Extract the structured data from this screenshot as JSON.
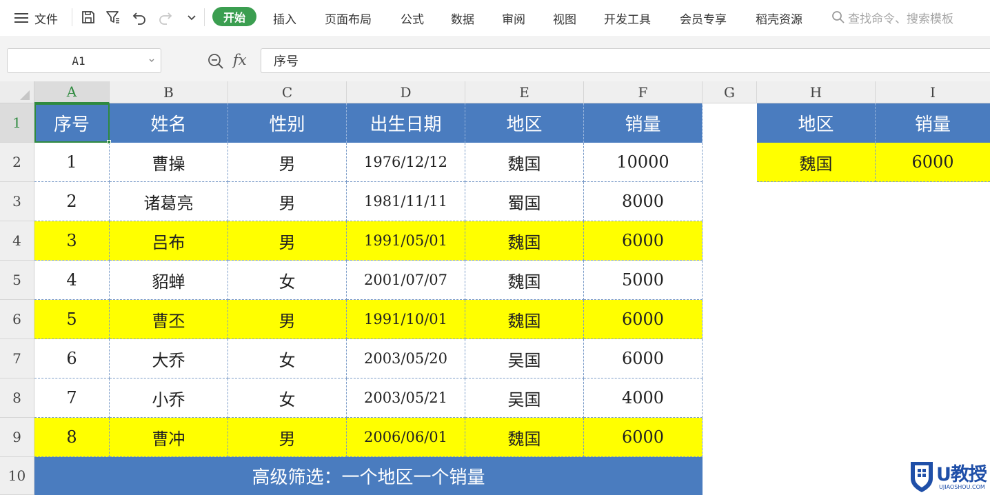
{
  "ribbon": {
    "file_label": "文件",
    "tabs": [
      "开始",
      "插入",
      "页面布局",
      "公式",
      "数据",
      "审阅",
      "视图",
      "开发工具",
      "会员专享",
      "稻壳资源"
    ],
    "active_tab": "开始",
    "search_placeholder": "查找命令、搜索模板",
    "accent_color": "#3b9e50"
  },
  "formula_bar": {
    "cell_ref": "A1",
    "fx_label": "fx",
    "formula": "序号"
  },
  "sheet": {
    "columns": [
      "A",
      "B",
      "C",
      "D",
      "E",
      "F",
      "G",
      "H",
      "I"
    ],
    "rows": [
      "1",
      "2",
      "3",
      "4",
      "5",
      "6",
      "7",
      "8",
      "9",
      "10"
    ],
    "selected_cell": "A1",
    "header_fill": "#4a7cbf",
    "highlight_fill": "#ffff00",
    "table_headers": [
      "序号",
      "姓名",
      "性别",
      "出生日期",
      "地区",
      "销量"
    ],
    "table_rows": [
      [
        "1",
        "曹操",
        "男",
        "1976/12/12",
        "魏国",
        "10000"
      ],
      [
        "2",
        "诸葛亮",
        "男",
        "1981/11/11",
        "蜀国",
        "8000"
      ],
      [
        "3",
        "吕布",
        "男",
        "1991/05/01",
        "魏国",
        "6000"
      ],
      [
        "4",
        "貂蝉",
        "女",
        "2001/07/07",
        "魏国",
        "5000"
      ],
      [
        "5",
        "曹丕",
        "男",
        "1991/10/01",
        "魏国",
        "6000"
      ],
      [
        "6",
        "大乔",
        "女",
        "2003/05/20",
        "吴国",
        "6000"
      ],
      [
        "7",
        "小乔",
        "女",
        "2003/05/21",
        "吴国",
        "4000"
      ],
      [
        "8",
        "曹冲",
        "男",
        "2006/06/01",
        "魏国",
        "6000"
      ]
    ],
    "highlighted_rows": [
      3,
      5,
      8
    ],
    "criteria_headers": [
      "地区",
      "销量"
    ],
    "criteria_values": [
      "魏国",
      "6000"
    ],
    "footer_text": "高级筛选：一个地区一个销量"
  },
  "watermark": {
    "logo_text": "U教授",
    "logo_sub": "UJIAOSHOU.COM"
  }
}
